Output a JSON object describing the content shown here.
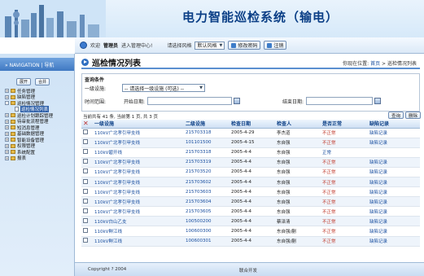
{
  "app": {
    "title": "电力智能巡检系统（输电）"
  },
  "topbar": {
    "welcome": "欢迎",
    "user": "管理员",
    "enter": "进入管理中心!",
    "style_label": "请选择风格",
    "style_value": "默认风格",
    "change_password": "修改密码",
    "logout": "注销"
  },
  "nav": {
    "header": "» NAVIGATION | 导航",
    "expand": "展开",
    "collapse": "合并",
    "items": [
      {
        "label": "任务管理",
        "kind": "folder",
        "sign": "+"
      },
      {
        "label": "缺陷管理",
        "kind": "folder",
        "sign": "+"
      },
      {
        "label": "巡检情况管理",
        "kind": "folder",
        "sign": "-"
      },
      {
        "label": "巡检情况列表",
        "kind": "doc",
        "child": true,
        "active": true
      },
      {
        "label": "巡检计划跟踪管理",
        "kind": "folder",
        "sign": "+"
      },
      {
        "label": "待审批流程管理",
        "kind": "folder",
        "sign": "+"
      },
      {
        "label": "短消息管理",
        "kind": "folder",
        "sign": "+"
      },
      {
        "label": "基础数据管理",
        "kind": "folder",
        "sign": "+"
      },
      {
        "label": "智能设备管理",
        "kind": "folder",
        "sign": "+"
      },
      {
        "label": "权限管理",
        "kind": "folder",
        "sign": "+"
      },
      {
        "label": "系统配置",
        "kind": "folder",
        "sign": "+"
      },
      {
        "label": "报表",
        "kind": "folder",
        "sign": "+"
      }
    ]
  },
  "page": {
    "title": "巡检情况列表",
    "crumb_prefix": "你现在位置: ",
    "crumb_home": "首页",
    "crumb_sep": " > ",
    "crumb_current": "巡检情况列表"
  },
  "query": {
    "title": "查询条件",
    "facility_label": "一级设施:",
    "facility_value": "-- 请选择一级设施 (可选) --",
    "time_label": "时间范围:",
    "start_label": "开始日期:",
    "end_label": "结束日期:"
  },
  "summary": "当前共有 41 条, 当前第 1 页, 共 3 页",
  "actions": {
    "search": "查询",
    "delete": "删除"
  },
  "table": {
    "headers": [
      "一级设施",
      "二级设施",
      "检查日期",
      "检查人",
      "是否正常",
      "缺陷记录"
    ],
    "rows": [
      [
        "110kV广北孝引甲支线",
        "215703318",
        "2005-4-29",
        "李杰道",
        "不正常",
        "缺陷记录"
      ],
      [
        "110kV广北孝引甲支线",
        "101101500",
        "2005-4-15",
        "东自强",
        "不正常",
        "缺陷记录"
      ],
      [
        "110kV碧开线",
        "215703318",
        "2005-4-4",
        "东自强",
        "正常",
        ""
      ],
      [
        "110kV广北孝引甲支线",
        "215703319",
        "2005-4-4",
        "东自强",
        "不正常",
        "缺陷记录"
      ],
      [
        "110kV广北孝引甲支线",
        "215703520",
        "2005-4-4",
        "东自强",
        "不正常",
        "缺陷记录"
      ],
      [
        "110kV广北孝引甲支线",
        "215703602",
        "2005-4-4",
        "东自强",
        "不正常",
        "缺陷记录"
      ],
      [
        "110kV广北孝引甲支线",
        "215703603",
        "2005-4-4",
        "东自强",
        "不正常",
        "缺陷记录"
      ],
      [
        "110kV广北孝引甲支线",
        "215703604",
        "2005-4-4",
        "东自强",
        "不正常",
        "缺陷记录"
      ],
      [
        "110kV广北孝引甲支线",
        "215703605",
        "2005-4-4",
        "东自强",
        "不正常",
        "缺陷记录"
      ],
      [
        "110kV白山乙支",
        "100500200",
        "2005-4-4",
        "蔡泽清",
        "不正常",
        "缺陷记录"
      ],
      [
        "110kV鲜江线",
        "100600300",
        "2005-4-4",
        "东自强/蒯",
        "不正常",
        "缺陷记录"
      ],
      [
        "110kV鲜江线",
        "100600301",
        "2005-4-4",
        "东自强/蒯",
        "不正常",
        "缺陷记录"
      ]
    ]
  },
  "footer": {
    "copyright": "Copyright ? 2004",
    "dev": "联合开发"
  }
}
